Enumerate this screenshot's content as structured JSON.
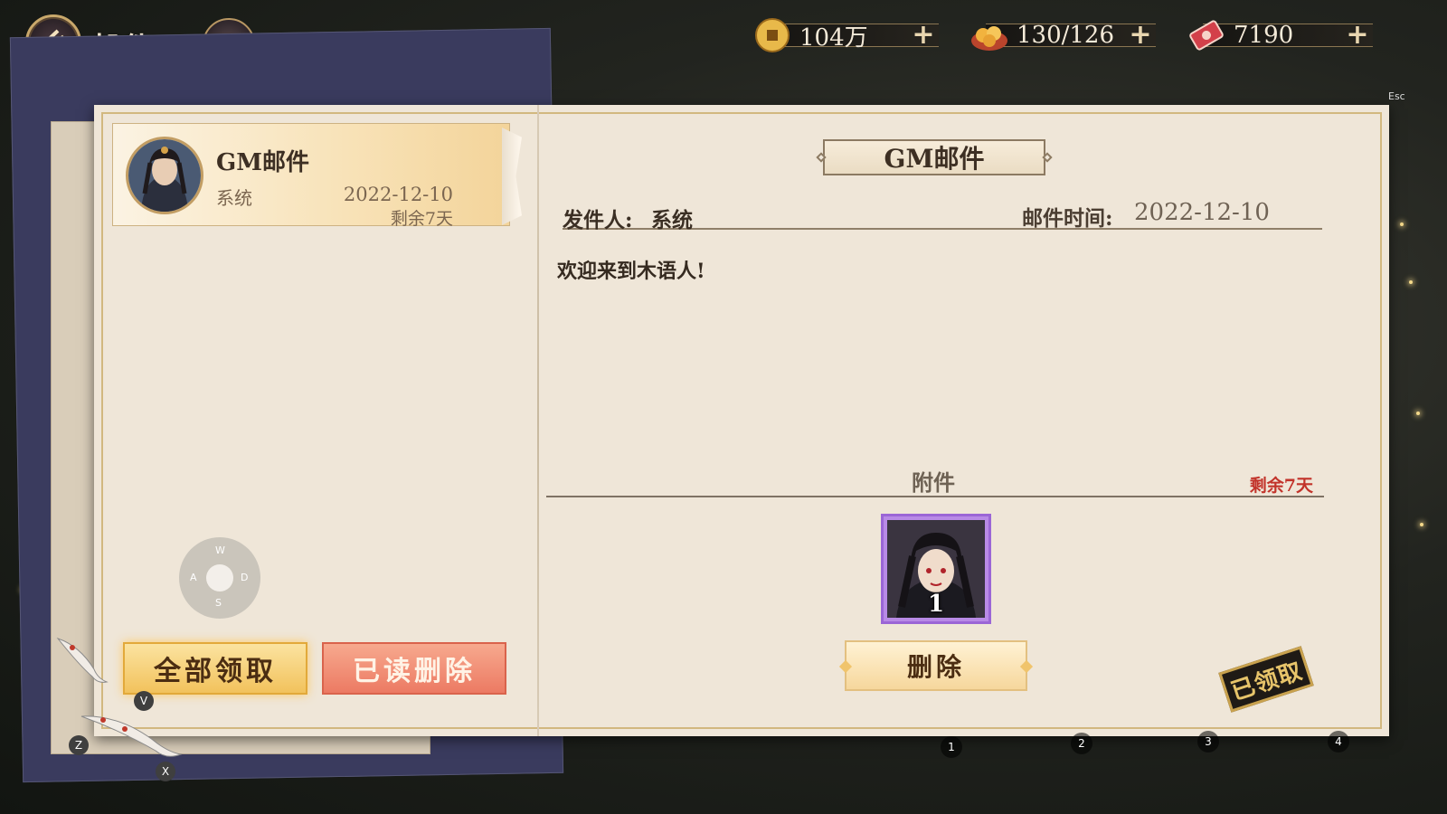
{
  "header": {
    "title": "邮件",
    "resources": [
      {
        "name": "copper-coin",
        "value": "104万"
      },
      {
        "name": "food",
        "value": "130/126"
      },
      {
        "name": "ticket",
        "value": "7190"
      }
    ],
    "esc_hint": "Esc"
  },
  "mail_list": [
    {
      "title": "GM邮件",
      "sender": "系统",
      "date": "2022-12-10",
      "remaining": "剩余7天",
      "selected": true
    }
  ],
  "controls": {
    "wasd": {
      "up": "W",
      "left": "A",
      "right": "D",
      "down": "S"
    },
    "claim_all_label": "全部领取",
    "delete_read_label": "已读删除",
    "claim_all_key": "V",
    "key_z": "Z",
    "key_x": "X"
  },
  "detail": {
    "title": "GM邮件",
    "sender_label": "发件人:",
    "sender": "系统",
    "time_label": "邮件时间:",
    "time": "2022-12-10",
    "body": "欢迎来到木语人!",
    "attachment_label": "附件",
    "attachment_remaining": "剩余7天",
    "attachments": [
      {
        "count": "1"
      }
    ],
    "delete_label": "删除",
    "claimed_stamp": "已领取"
  },
  "hotbar": [
    "1",
    "2",
    "3",
    "4"
  ],
  "colors": {
    "accent_gold": "#f2c25c",
    "delete_red": "#ec7a63",
    "remaining_red": "#c2332a",
    "item_rarity_purple": "#b88ae6"
  }
}
